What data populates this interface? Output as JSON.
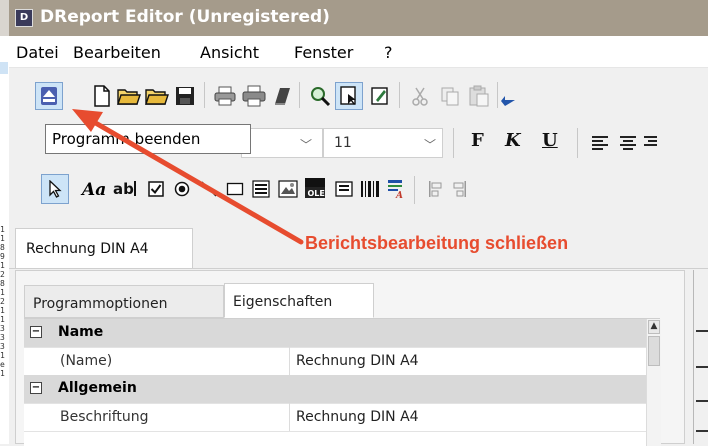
{
  "window": {
    "title": "DReport Editor (Unregistered)",
    "app_icon_letter": "D"
  },
  "menu": [
    "Datei",
    "Bearbeiten",
    "Ansicht",
    "Fenster",
    "?"
  ],
  "tooltip": "Programm beenden",
  "format_bar": {
    "font_size": "11",
    "bold_label": "F",
    "italic_label": "K",
    "underline_label": "U"
  },
  "text_tool_label": "Aa",
  "report_tab": "Rechnung DIN A4",
  "annotation": "Berichtsbearbeitung schließen",
  "properties": {
    "tabs": [
      "Programmoptionen",
      "Eigenschaften"
    ],
    "rows": [
      {
        "category": "Name"
      },
      {
        "name": "(Name)",
        "value": "Rechnung DIN A4"
      },
      {
        "category": "Allgemein"
      },
      {
        "name": "Beschriftung",
        "value": "Rechnung DIN A4"
      }
    ]
  },
  "colors": {
    "title_bar": "#a59b8b",
    "annotation_red": "#e74c2f",
    "selected_button": "#cde4f7"
  }
}
